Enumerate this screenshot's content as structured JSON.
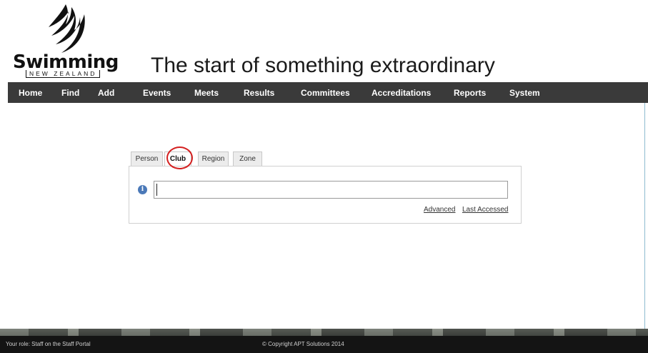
{
  "brand": {
    "name": "Swimming",
    "sub": "NEW ZEALAND",
    "tagline": "The start of something extraordinary"
  },
  "nav": {
    "items": [
      "Home",
      "Find",
      "Add",
      "Events",
      "Meets",
      "Results",
      "Committees",
      "Accreditations",
      "Reports",
      "System"
    ]
  },
  "search": {
    "tabs": [
      "Person",
      "Club",
      "Region",
      "Zone"
    ],
    "active_tab": "Club",
    "input_value": "",
    "advanced_label": "Advanced",
    "last_accessed_label": "Last Accessed"
  },
  "footer": {
    "role": "Your role: Staff on the Staff Portal",
    "copyright": "© Copyright APT Solutions 2014"
  },
  "colors": {
    "nav_bg": "#3a3a3a",
    "highlight": "#d42020",
    "info_icon": "#4b79b8"
  },
  "icons": {
    "logo": "swimmer-swoosh-icon",
    "info": "info-icon"
  }
}
